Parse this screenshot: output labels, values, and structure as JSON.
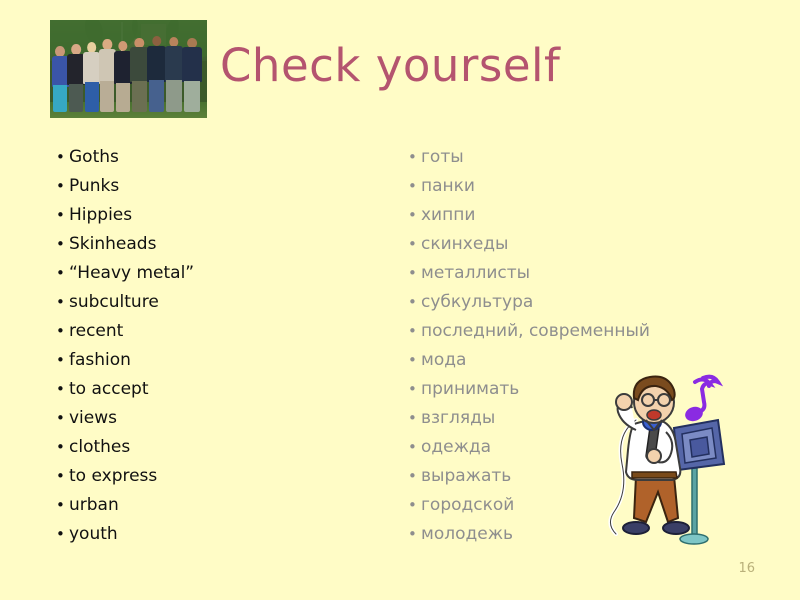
{
  "slide": {
    "title": "Check yourself",
    "page_number": "16",
    "background_color": "#fffcc6",
    "title_color": "#b4546f",
    "english_color": "#111111",
    "russian_color": "#8e8e8e",
    "page_number_color": "#b9b07a"
  },
  "photo": {
    "name": "group-of-young-people-photo",
    "description": "Group photo of young people standing outdoors in front of trees"
  },
  "clipart": {
    "name": "cartoon-singer-with-microphone",
    "description": "Cartoon man in white shirt and brown trousers singing into a blue microphone beside a blue speaker on a stand with a purple music note",
    "shirt_color": "#ffffff",
    "trousers_color": "#b0622a",
    "hair_color": "#7a4b1e",
    "mic_color": "#3a5fd0",
    "speaker_color": "#5566a8",
    "stand_color": "#5ba3a3",
    "note_color": "#8a2be2",
    "shoe_color": "#3a3f66"
  },
  "vocabulary": {
    "english_heading": "",
    "russian_heading": "",
    "bullet_glyph": "•",
    "english": [
      "Goths",
      "Punks",
      "Hippies",
      "Skinheads",
      "“Heavy metal”",
      "subculture",
      "recent",
      "fashion",
      "to accept",
      "views",
      "clothes",
      "to express",
      "urban",
      "youth"
    ],
    "russian": [
      "готы",
      "панки",
      "хиппи",
      "скинхеды",
      "металлисты",
      "субкультура",
      "последний, современный",
      "мода",
      "принимать",
      "взгляды",
      "одежда",
      "выражать",
      "городской",
      "молодежь"
    ]
  }
}
